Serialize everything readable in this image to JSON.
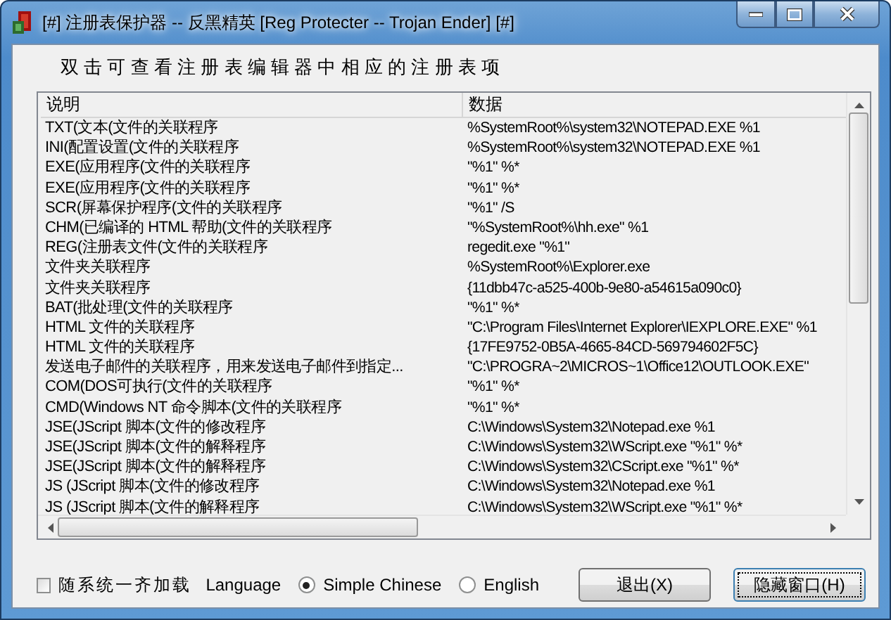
{
  "window": {
    "title": "[#] 注册表保护器 -- 反黑精英 [Reg Protecter -- Trojan Ender] [#]"
  },
  "instruction": "双 击 可 查 看 注 册 表 编 辑 器 中 相 应 的 注 册 表 项",
  "table": {
    "columns": [
      "说明",
      "数据"
    ],
    "rows": [
      {
        "description": "TXT(文本(文件的关联程序",
        "data": "%SystemRoot%\\system32\\NOTEPAD.EXE %1"
      },
      {
        "description": "INI(配置设置(文件的关联程序",
        "data": "%SystemRoot%\\system32\\NOTEPAD.EXE %1"
      },
      {
        "description": "EXE(应用程序(文件的关联程序",
        "data": "\"%1\" %*"
      },
      {
        "description": "EXE(应用程序(文件的关联程序",
        "data": "\"%1\" %*"
      },
      {
        "description": "SCR(屏幕保护程序(文件的关联程序",
        "data": "\"%1\" /S"
      },
      {
        "description": "CHM(已编译的 HTML 帮助(文件的关联程序",
        "data": "\"%SystemRoot%\\hh.exe\" %1"
      },
      {
        "description": "REG(注册表文件(文件的关联程序",
        "data": "regedit.exe \"%1\""
      },
      {
        "description": "文件夹关联程序",
        "data": "%SystemRoot%\\Explorer.exe"
      },
      {
        "description": "文件夹关联程序",
        "data": "{11dbb47c-a525-400b-9e80-a54615a090c0}"
      },
      {
        "description": "BAT(批处理(文件的关联程序",
        "data": "\"%1\" %*"
      },
      {
        "description": "HTML 文件的关联程序",
        "data": "\"C:\\Program Files\\Internet Explorer\\IEXPLORE.EXE\" %1"
      },
      {
        "description": "HTML 文件的关联程序",
        "data": "{17FE9752-0B5A-4665-84CD-569794602F5C}"
      },
      {
        "description": "发送电子邮件的关联程序，用来发送电子邮件到指定...",
        "data": "\"C:\\PROGRA~2\\MICROS~1\\Office12\\OUTLOOK.EXE\""
      },
      {
        "description": "COM(DOS可执行(文件的关联程序",
        "data": "\"%1\" %*"
      },
      {
        "description": "CMD(Windows NT 命令脚本(文件的关联程序",
        "data": "\"%1\" %*"
      },
      {
        "description": "JSE(JScript 脚本(文件的修改程序",
        "data": "C:\\Windows\\System32\\Notepad.exe %1"
      },
      {
        "description": "JSE(JScript 脚本(文件的解释程序",
        "data": "C:\\Windows\\System32\\WScript.exe \"%1\" %*"
      },
      {
        "description": "JSE(JScript 脚本(文件的解释程序",
        "data": "C:\\Windows\\System32\\CScript.exe \"%1\" %*"
      },
      {
        "description": "JS (JScript 脚本(文件的修改程序",
        "data": "C:\\Windows\\System32\\Notepad.exe %1"
      },
      {
        "description": "JS (JScript 脚本(文件的解释程序",
        "data": "C:\\Windows\\System32\\WScript.exe \"%1\" %*"
      }
    ]
  },
  "autostart": {
    "label": "随系统一齐加载",
    "checked": false
  },
  "language": {
    "label": "Language",
    "options": [
      {
        "label": "Simple Chinese",
        "selected": true
      },
      {
        "label": "English",
        "selected": false
      }
    ]
  },
  "buttons": [
    {
      "label": "退出(X)",
      "focused": false
    },
    {
      "label": "隐藏窗口(H)",
      "focused": true
    }
  ]
}
